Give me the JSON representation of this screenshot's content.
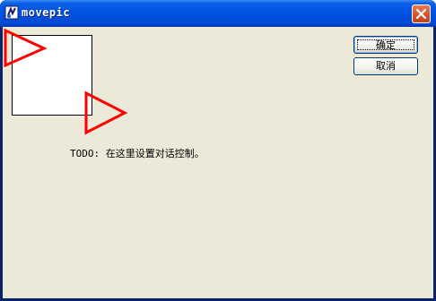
{
  "window": {
    "title": "movepic"
  },
  "buttons": {
    "ok_label": "确定",
    "cancel_label": "取消"
  },
  "content": {
    "todo_text": "TODO: 在这里设置对话控制。"
  },
  "icons": {
    "app": "app-icon",
    "close": "close-icon",
    "arrow_left": "triangle-arrow-icon",
    "arrow_right": "triangle-arrow-icon"
  },
  "colors": {
    "titlebar": "#0054e3",
    "client_background": "#ece9d8",
    "close_button": "#d9582d",
    "arrow_stroke": "#ff0000"
  }
}
